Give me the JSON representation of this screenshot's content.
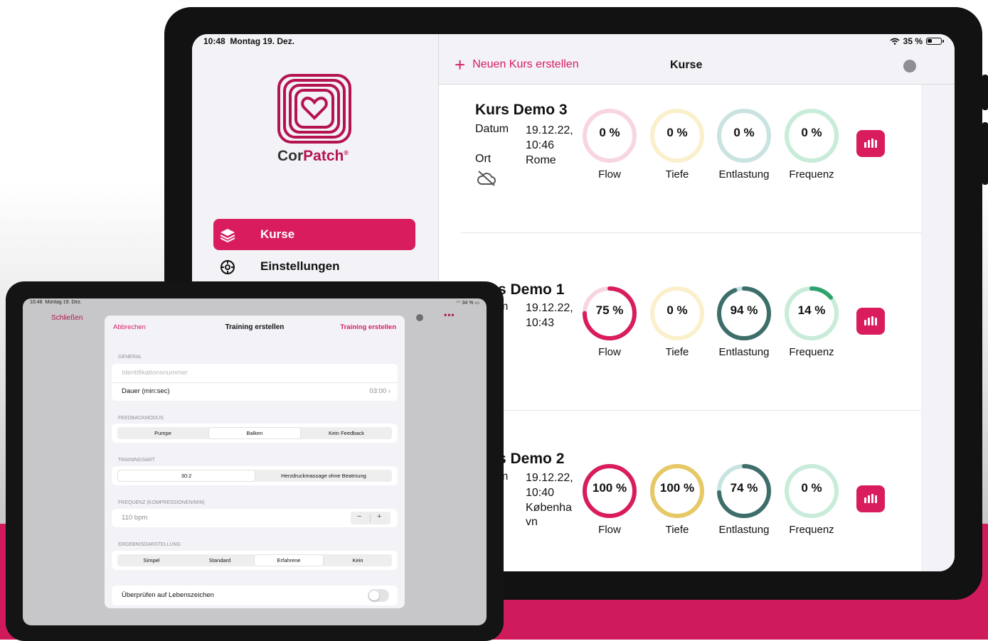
{
  "colors": {
    "accent": "#d81c5e",
    "flow": "#d81c5e",
    "tiefe": "#e6c866",
    "entlastung": "#3e6e6a",
    "frequenz": "#2ea36e"
  },
  "big": {
    "status": {
      "time": "10:48",
      "date": "Montag 19. Dez.",
      "battery": "35 %"
    },
    "logo": {
      "brand_a": "Cor",
      "brand_b": "Patch",
      "reg": "®"
    },
    "nav": [
      {
        "label": "Kurse",
        "icon": "layers-icon",
        "active": true
      },
      {
        "label": "Einstellungen",
        "icon": "gear-icon",
        "active": false
      }
    ],
    "header": {
      "new_course": "Neuen Kurs erstellen",
      "title": "Kurse"
    },
    "courses": [
      {
        "title": "Kurs Demo 3",
        "date_label": "Datum",
        "date": "19.12.22,",
        "time": "10:46",
        "place_label": "Ort",
        "place": "Rome",
        "sync": "cloud-off-icon",
        "metrics": [
          {
            "label": "Flow",
            "value": 0,
            "text": "0 %"
          },
          {
            "label": "Tiefe",
            "value": 0,
            "text": "0 %"
          },
          {
            "label": "Entlastung",
            "value": 0,
            "text": "0 %"
          },
          {
            "label": "Frequenz",
            "value": 0,
            "text": "0 %"
          }
        ]
      },
      {
        "title": "s Demo 1",
        "date_label": "m",
        "date": "19.12.22,",
        "time": "10:43",
        "metrics": [
          {
            "label": "Flow",
            "value": 75,
            "text": "75 %"
          },
          {
            "label": "Tiefe",
            "value": 0,
            "text": "0 %"
          },
          {
            "label": "Entlastung",
            "value": 94,
            "text": "94 %"
          },
          {
            "label": "Frequenz",
            "value": 14,
            "text": "14 %"
          }
        ]
      },
      {
        "title": "s Demo 2",
        "date_label": "m",
        "date": "19.12.22,",
        "time": "10:40",
        "place": "Københa",
        "place2": "vn",
        "metrics": [
          {
            "label": "Flow",
            "value": 100,
            "text": "100 %"
          },
          {
            "label": "Tiefe",
            "value": 100,
            "text": "100 %"
          },
          {
            "label": "Entlastung",
            "value": 74,
            "text": "74 %"
          },
          {
            "label": "Frequenz",
            "value": 0,
            "text": "0 %"
          }
        ]
      }
    ]
  },
  "small": {
    "status": {
      "time": "10:48",
      "date": "Montag 19. Dez.",
      "battery": "34 %"
    },
    "close": "Schließen",
    "more": "•••",
    "modal": {
      "cancel": "Abbrechen",
      "title": "Training erstellen",
      "create": "Training erstellen",
      "general": {
        "section": "GENERAL",
        "id_placeholder": "Identifikationsnummer",
        "duration_label": "Dauer (min:sec)",
        "duration_value": "03:00"
      },
      "feedback": {
        "section": "FEEDBACKMODUS",
        "options": [
          "Pumpe",
          "Balken",
          "Kein Feedback"
        ],
        "selected": "Balken"
      },
      "training": {
        "section": "TRAININGSART",
        "options": [
          "30:2",
          "Herzdruckmassage ohne Beatmung"
        ],
        "selected": "30:2"
      },
      "frequency": {
        "section": "FREQUENZ (KOMPRESSIONEN/MIN)",
        "value": "110 bpm",
        "minus": "−",
        "plus": "+"
      },
      "results": {
        "section": "ERGEBNISDARSTELLUNG",
        "options": [
          "Simpel",
          "Standard",
          "Erfahrene",
          "Kein"
        ],
        "selected": "Erfahrene"
      },
      "vital": {
        "label": "Überprüfen auf Lebenszeichen",
        "on": false
      }
    }
  }
}
